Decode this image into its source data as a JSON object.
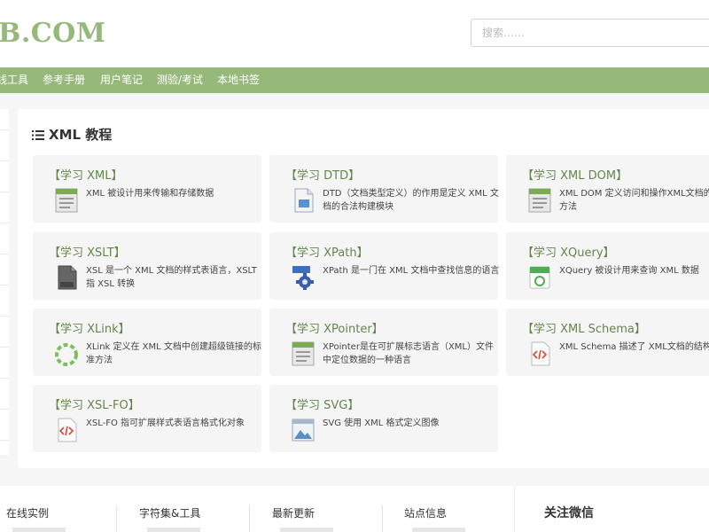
{
  "header": {
    "logo": "B.COM",
    "search_placeholder": "搜索……"
  },
  "nav": {
    "items": [
      "线工具",
      "参考手册",
      "用户笔记",
      "测验/考试",
      "本地书签"
    ]
  },
  "main": {
    "title": "XML 教程"
  },
  "cards": [
    {
      "title": "【学习 XML】",
      "desc": "XML 被设计用来传输和存储数据",
      "icon": "xml-doc-icon"
    },
    {
      "title": "【学习 DTD】",
      "desc": "DTD（文档类型定义）的作用是定义 XML 文档的合法构建模块",
      "icon": "dtd-file-icon"
    },
    {
      "title": "【学习 XML DOM】",
      "desc": "XML DOM 定义访问和操作XML文档的标准方法",
      "icon": "xml-dom-icon"
    },
    {
      "title": "【学习 XSLT】",
      "desc": "XSL 是一个 XML 文档的样式表语言，XSLT 指 XSL 转换",
      "icon": "xslt-file-icon"
    },
    {
      "title": "【学习 XPath】",
      "desc": "XPath 是一门在 XML 文档中查找信息的语言",
      "icon": "xpath-gear-icon"
    },
    {
      "title": "【学习 XQuery】",
      "desc": "XQuery 被设计用来查询 XML 数据",
      "icon": "xquery-icon"
    },
    {
      "title": "【学习 XLink】",
      "desc": "XLink 定义在 XML 文档中创建超级链接的标准方法",
      "icon": "xlink-ring-icon"
    },
    {
      "title": "【学习 XPointer】",
      "desc": "XPointer是在可扩展标志语言（XML）文件中定位数据的一种语言",
      "icon": "xpointer-doc-icon"
    },
    {
      "title": "【学习 XML Schema】",
      "desc": "XML Schema 描述了 XML文档的结构",
      "icon": "schema-code-icon"
    },
    {
      "title": "【学习 XSL-FO】",
      "desc": "XSL-FO 指可扩展样式表语言格式化对象",
      "icon": "xslfo-code-icon"
    },
    {
      "title": "【学习 SVG】",
      "desc": "SVG 使用 XML 格式定义图像",
      "icon": "svg-image-icon"
    }
  ],
  "footer": {
    "cols": [
      "在线实例",
      "字符集&工具",
      "最新更新",
      "站点信息"
    ],
    "wechat": "关注微信"
  },
  "colors": {
    "accent": "#96b97b",
    "card_title": "#64854c"
  }
}
